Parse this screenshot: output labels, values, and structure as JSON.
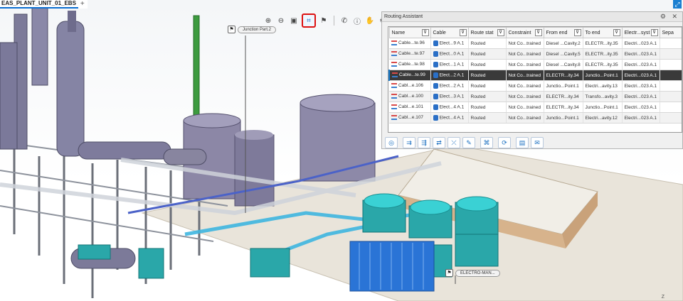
{
  "tab": {
    "title": "EAS_PLANT_UNIT_01_EBS",
    "add": "+"
  },
  "callouts": {
    "junction": "Junction Part.2",
    "electro": "ELECTRO-MAN..."
  },
  "panel": {
    "title": "Routing Assistant",
    "columns": [
      "Name",
      "Cable",
      "Route stat",
      "Constraint",
      "From end",
      "To end",
      "Electr...syst",
      "Sepa"
    ],
    "rows": [
      [
        "Cable...te.96",
        "Elect...9 A.1",
        "Routed",
        "Not Co...trained",
        "Diesel ...Cavity.2",
        "ELECTR...ity.35",
        "Electri...023 A.1",
        ""
      ],
      [
        "Cable...te.97",
        "Elect...0 A.1",
        "Routed",
        "Not Co...trained",
        "Diesel ...Cavity.5",
        "ELECTR...ity.35",
        "Electri...023 A.1",
        ""
      ],
      [
        "Cable...te.98",
        "Elect...1 A.1",
        "Routed",
        "Not Co...trained",
        "Diesel ...Cavity.8",
        "ELECTR...ity.35",
        "Electri...023 A.1",
        ""
      ],
      [
        "Cable...te.99",
        "Elect...2 A.1",
        "Routed",
        "Not Co...trained",
        "ELECTR...ity.34",
        "Junctio...Point.1",
        "Electri...023 A.1",
        ""
      ],
      [
        "Cabl...e.106",
        "Elect...2 A.1",
        "Routed",
        "Not Co...trained",
        "Junctio...Point.1",
        "Electri...avity.13",
        "Electri...023 A.1",
        ""
      ],
      [
        "Cabl...e.100",
        "Elect...3 A.1",
        "Routed",
        "Not Co...trained",
        "ELECTR...ity.34",
        "Transfo...avity.3",
        "Electri...023 A.1",
        ""
      ],
      [
        "Cabl...e.101",
        "Elect...4 A.1",
        "Routed",
        "Not Co...trained",
        "ELECTR...ity.34",
        "Junctio...Point.1",
        "Electri...023 A.1",
        ""
      ],
      [
        "Cabl...e.107",
        "Elect...4 A.1",
        "Routed",
        "Not Co...trained",
        "Junctio...Point.1",
        "Electri...avity.12",
        "Electri...023 A.1",
        ""
      ]
    ],
    "selected_row": 3,
    "controls": "⚙ ✕"
  },
  "compass": "Z"
}
